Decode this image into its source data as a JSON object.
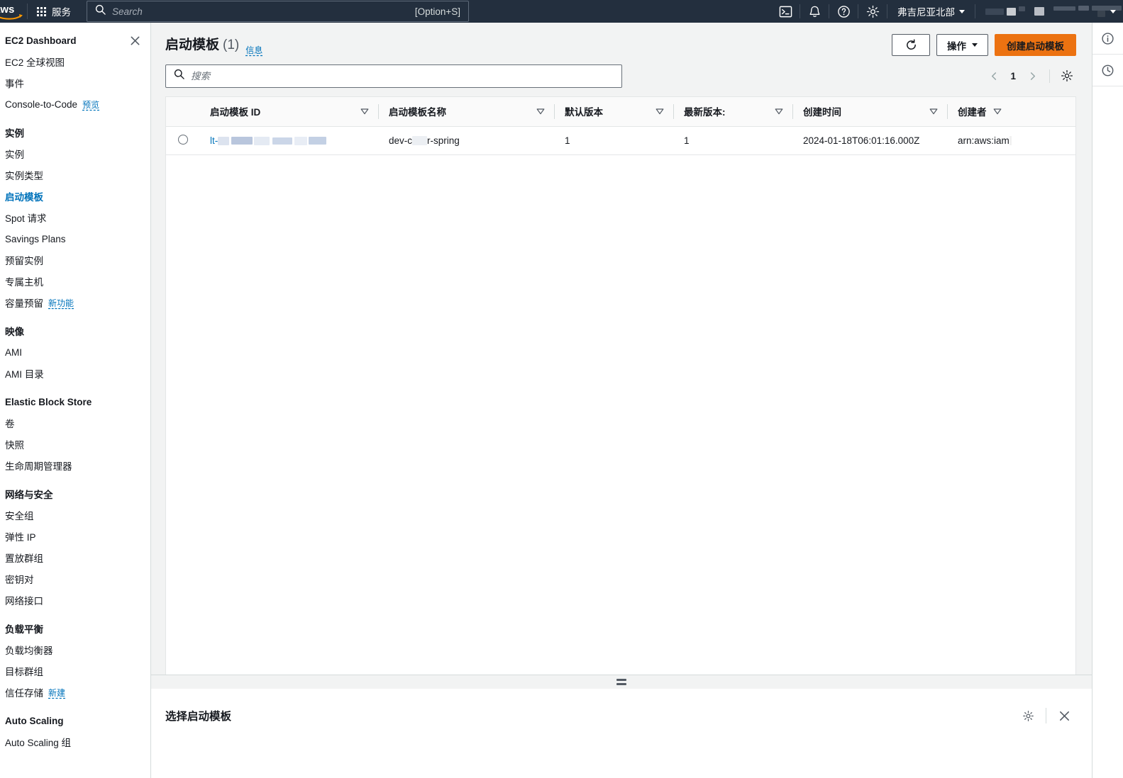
{
  "topnav": {
    "logo_alt": "aws",
    "services_label": "服务",
    "search": {
      "placeholder": "Search",
      "value": "",
      "shortcut_hint": "[Option+S]"
    },
    "icons": [
      {
        "name": "cloudshell-icon",
        "glyph": ">_"
      },
      {
        "name": "notifications-bell-icon",
        "glyph": "bell"
      },
      {
        "name": "help-icon",
        "glyph": "?"
      },
      {
        "name": "settings-gear-icon",
        "glyph": "gear"
      }
    ],
    "region_label": "弗吉尼亚北部",
    "account_label": ""
  },
  "sidebar": {
    "header_title": "EC2 Dashboard",
    "close_label": "×",
    "items": [
      {
        "label": "EC2 全球视图",
        "type": "link"
      },
      {
        "label": "事件",
        "type": "link"
      },
      {
        "label": "Console-to-Code",
        "type": "link",
        "badge": "预览"
      },
      {
        "label": "实例",
        "type": "group"
      },
      {
        "label": "实例",
        "type": "link"
      },
      {
        "label": "实例类型",
        "type": "link"
      },
      {
        "label": "启动模板",
        "type": "link",
        "active": true
      },
      {
        "label": "Spot 请求",
        "type": "link"
      },
      {
        "label": "Savings Plans",
        "type": "link"
      },
      {
        "label": "预留实例",
        "type": "link"
      },
      {
        "label": "专属主机",
        "type": "link"
      },
      {
        "label": "容量预留",
        "type": "link",
        "badge": "新功能"
      },
      {
        "label": "映像",
        "type": "group"
      },
      {
        "label": "AMI",
        "type": "link"
      },
      {
        "label": "AMI 目录",
        "type": "link"
      },
      {
        "label": "Elastic Block Store",
        "type": "group"
      },
      {
        "label": "卷",
        "type": "link"
      },
      {
        "label": "快照",
        "type": "link"
      },
      {
        "label": "生命周期管理器",
        "type": "link"
      },
      {
        "label": "网络与安全",
        "type": "group"
      },
      {
        "label": "安全组",
        "type": "link"
      },
      {
        "label": "弹性 IP",
        "type": "link"
      },
      {
        "label": "置放群组",
        "type": "link"
      },
      {
        "label": "密钥对",
        "type": "link"
      },
      {
        "label": "网络接口",
        "type": "link"
      },
      {
        "label": "负载平衡",
        "type": "group"
      },
      {
        "label": "负载均衡器",
        "type": "link"
      },
      {
        "label": "目标群组",
        "type": "link"
      },
      {
        "label": "信任存储",
        "type": "link",
        "badge": "新建"
      },
      {
        "label": "Auto Scaling",
        "type": "group"
      },
      {
        "label": "Auto Scaling 组",
        "type": "link"
      }
    ]
  },
  "main": {
    "page_title": "启动模板",
    "page_count": "(1)",
    "info_link": "信息",
    "refresh_label": "",
    "actions_label": "操作",
    "create_label": "创建启动模板",
    "search": {
      "placeholder": "搜索",
      "value": ""
    },
    "pagination": {
      "prev": "‹",
      "page": "1",
      "next": "›"
    },
    "table": {
      "columns": [
        {
          "label": "启动模板 ID",
          "sortable": true
        },
        {
          "label": "启动模板名称",
          "sortable": true
        },
        {
          "label": "默认版本",
          "sortable": true
        },
        {
          "label": "最新版本:",
          "sortable": true
        },
        {
          "label": "创建时间",
          "sortable": true
        },
        {
          "label": "创建者",
          "sortable": true
        }
      ],
      "rows": [
        {
          "selected": false,
          "template_id_prefix": "lt-",
          "template_id_redacted": true,
          "template_name_prefix": "dev-c",
          "template_name_suffix": "r-spring",
          "template_name_redacted": true,
          "default_version": "1",
          "latest_version": "1",
          "create_time": "2024-01-18T06:01:16.000Z",
          "creator_prefix": "arn:aws:iam",
          "creator_suffix": ".",
          "creator_redacted": true
        }
      ]
    }
  },
  "bottom_panel": {
    "title": "选择启动模板",
    "gear_label": "",
    "close_label": "×"
  },
  "right_rail": {
    "items": [
      {
        "name": "info-circle-icon"
      },
      {
        "name": "history-clock-icon"
      }
    ]
  },
  "colors": {
    "nav_bg": "#232f3e",
    "accent_orange": "#ec7211",
    "link_blue": "#0073bb",
    "page_bg": "#f2f3f3",
    "border": "#d5dbdb"
  }
}
